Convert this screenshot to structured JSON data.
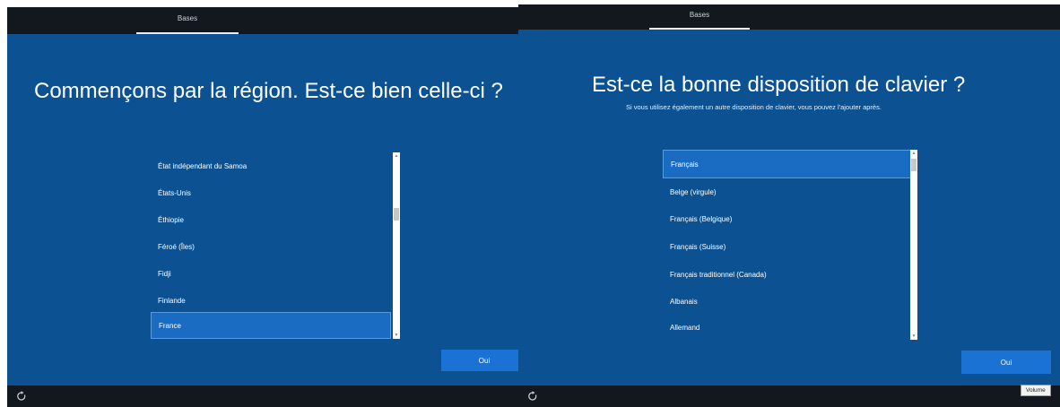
{
  "left": {
    "tab_label": "Bases",
    "title": "Commençons par la région. Est-ce bien celle-ci ?",
    "list_items": [
      "État indépendant du Samoa",
      "États-Unis",
      "Éthiopie",
      "Féroé (Îles)",
      "Fidji",
      "Finlande",
      "France"
    ],
    "selected_index": 6,
    "button_label": "Oui"
  },
  "right": {
    "tab_label": "Bases",
    "title": "Est-ce la bonne disposition de clavier ?",
    "subtitle": "Si vous utilisez également un autre disposition de clavier, vous pouvez l'ajouter après.",
    "list_items": [
      "Français",
      "Belge (virgule)",
      "Français (Belgique)",
      "Français (Suisse)",
      "Français traditionnel (Canada)",
      "Albanais",
      "Allemand"
    ],
    "selected_index": 0,
    "button_label": "Oui",
    "tooltip": "Volume"
  },
  "icons": {
    "accessibility": "accessibility-icon",
    "scroll_up": "scroll-up-icon",
    "scroll_down": "scroll-down-icon"
  },
  "colors": {
    "background": "#0c5293",
    "selected_item": "#1a6cc3",
    "button": "#1a73d4",
    "bar": "#12181d"
  }
}
